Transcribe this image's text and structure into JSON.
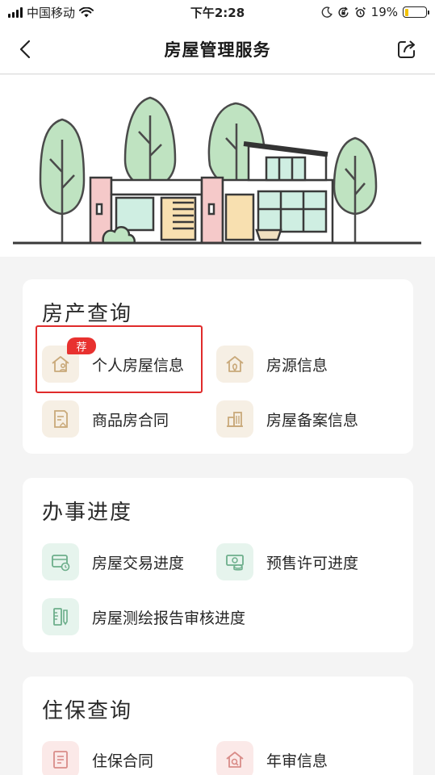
{
  "status_bar": {
    "carrier": "中国移动",
    "time": "下午2:28",
    "battery_percent": "19%",
    "battery_level": 0.19,
    "icons": [
      "signal-icon",
      "wifi-icon",
      "moon-icon",
      "rotation-lock-icon",
      "alarm-icon",
      "battery-icon"
    ]
  },
  "nav": {
    "title": "房屋管理服务",
    "back_icon": "chevron-left-icon",
    "share_icon": "share-icon"
  },
  "sections": [
    {
      "title": "房产查询",
      "items": [
        {
          "label": "个人房屋信息",
          "icon": "house-person-icon",
          "badge": "荐"
        },
        {
          "label": "房源信息",
          "icon": "house-pin-icon"
        },
        {
          "label": "商品房合同",
          "icon": "contract-icon"
        },
        {
          "label": "房屋备案信息",
          "icon": "building-icon"
        }
      ]
    },
    {
      "title": "办事进度",
      "items": [
        {
          "label": "房屋交易进度",
          "icon": "card-clock-icon"
        },
        {
          "label": "预售许可进度",
          "icon": "money-stack-icon"
        },
        {
          "label": "房屋测绘报告审核进度",
          "icon": "ruler-report-icon"
        }
      ]
    },
    {
      "title": "住保查询",
      "items": [
        {
          "label": "住保合同",
          "icon": "document-icon"
        },
        {
          "label": "年审信息",
          "icon": "house-search-icon"
        }
      ]
    }
  ],
  "colors": {
    "badge": "#e8312f",
    "highlight": "#e02b2b",
    "icon_bg_beige": "#f6efe4",
    "icon_bg_green": "#e6f4ed",
    "icon_bg_pink": "#fbe9e8",
    "icon_beige": "#c9a97a",
    "icon_green": "#6dae8b",
    "icon_pink": "#d98c88"
  }
}
